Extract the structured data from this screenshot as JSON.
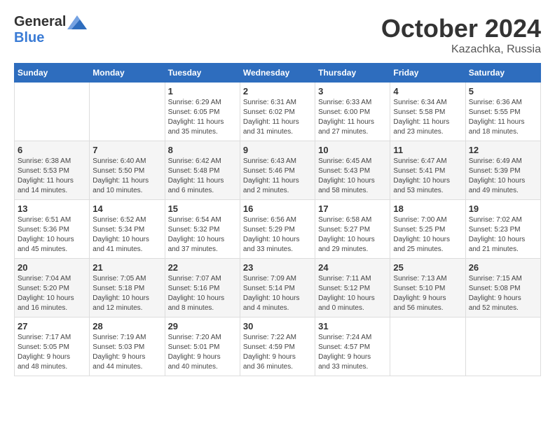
{
  "header": {
    "logo_general": "General",
    "logo_blue": "Blue",
    "month": "October 2024",
    "location": "Kazachka, Russia"
  },
  "weekdays": [
    "Sunday",
    "Monday",
    "Tuesday",
    "Wednesday",
    "Thursday",
    "Friday",
    "Saturday"
  ],
  "weeks": [
    [
      {
        "day": "",
        "info": ""
      },
      {
        "day": "",
        "info": ""
      },
      {
        "day": "1",
        "info": "Sunrise: 6:29 AM\nSunset: 6:05 PM\nDaylight: 11 hours\nand 35 minutes."
      },
      {
        "day": "2",
        "info": "Sunrise: 6:31 AM\nSunset: 6:02 PM\nDaylight: 11 hours\nand 31 minutes."
      },
      {
        "day": "3",
        "info": "Sunrise: 6:33 AM\nSunset: 6:00 PM\nDaylight: 11 hours\nand 27 minutes."
      },
      {
        "day": "4",
        "info": "Sunrise: 6:34 AM\nSunset: 5:58 PM\nDaylight: 11 hours\nand 23 minutes."
      },
      {
        "day": "5",
        "info": "Sunrise: 6:36 AM\nSunset: 5:55 PM\nDaylight: 11 hours\nand 18 minutes."
      }
    ],
    [
      {
        "day": "6",
        "info": "Sunrise: 6:38 AM\nSunset: 5:53 PM\nDaylight: 11 hours\nand 14 minutes."
      },
      {
        "day": "7",
        "info": "Sunrise: 6:40 AM\nSunset: 5:50 PM\nDaylight: 11 hours\nand 10 minutes."
      },
      {
        "day": "8",
        "info": "Sunrise: 6:42 AM\nSunset: 5:48 PM\nDaylight: 11 hours\nand 6 minutes."
      },
      {
        "day": "9",
        "info": "Sunrise: 6:43 AM\nSunset: 5:46 PM\nDaylight: 11 hours\nand 2 minutes."
      },
      {
        "day": "10",
        "info": "Sunrise: 6:45 AM\nSunset: 5:43 PM\nDaylight: 10 hours\nand 58 minutes."
      },
      {
        "day": "11",
        "info": "Sunrise: 6:47 AM\nSunset: 5:41 PM\nDaylight: 10 hours\nand 53 minutes."
      },
      {
        "day": "12",
        "info": "Sunrise: 6:49 AM\nSunset: 5:39 PM\nDaylight: 10 hours\nand 49 minutes."
      }
    ],
    [
      {
        "day": "13",
        "info": "Sunrise: 6:51 AM\nSunset: 5:36 PM\nDaylight: 10 hours\nand 45 minutes."
      },
      {
        "day": "14",
        "info": "Sunrise: 6:52 AM\nSunset: 5:34 PM\nDaylight: 10 hours\nand 41 minutes."
      },
      {
        "day": "15",
        "info": "Sunrise: 6:54 AM\nSunset: 5:32 PM\nDaylight: 10 hours\nand 37 minutes."
      },
      {
        "day": "16",
        "info": "Sunrise: 6:56 AM\nSunset: 5:29 PM\nDaylight: 10 hours\nand 33 minutes."
      },
      {
        "day": "17",
        "info": "Sunrise: 6:58 AM\nSunset: 5:27 PM\nDaylight: 10 hours\nand 29 minutes."
      },
      {
        "day": "18",
        "info": "Sunrise: 7:00 AM\nSunset: 5:25 PM\nDaylight: 10 hours\nand 25 minutes."
      },
      {
        "day": "19",
        "info": "Sunrise: 7:02 AM\nSunset: 5:23 PM\nDaylight: 10 hours\nand 21 minutes."
      }
    ],
    [
      {
        "day": "20",
        "info": "Sunrise: 7:04 AM\nSunset: 5:20 PM\nDaylight: 10 hours\nand 16 minutes."
      },
      {
        "day": "21",
        "info": "Sunrise: 7:05 AM\nSunset: 5:18 PM\nDaylight: 10 hours\nand 12 minutes."
      },
      {
        "day": "22",
        "info": "Sunrise: 7:07 AM\nSunset: 5:16 PM\nDaylight: 10 hours\nand 8 minutes."
      },
      {
        "day": "23",
        "info": "Sunrise: 7:09 AM\nSunset: 5:14 PM\nDaylight: 10 hours\nand 4 minutes."
      },
      {
        "day": "24",
        "info": "Sunrise: 7:11 AM\nSunset: 5:12 PM\nDaylight: 10 hours\nand 0 minutes."
      },
      {
        "day": "25",
        "info": "Sunrise: 7:13 AM\nSunset: 5:10 PM\nDaylight: 9 hours\nand 56 minutes."
      },
      {
        "day": "26",
        "info": "Sunrise: 7:15 AM\nSunset: 5:08 PM\nDaylight: 9 hours\nand 52 minutes."
      }
    ],
    [
      {
        "day": "27",
        "info": "Sunrise: 7:17 AM\nSunset: 5:05 PM\nDaylight: 9 hours\nand 48 minutes."
      },
      {
        "day": "28",
        "info": "Sunrise: 7:19 AM\nSunset: 5:03 PM\nDaylight: 9 hours\nand 44 minutes."
      },
      {
        "day": "29",
        "info": "Sunrise: 7:20 AM\nSunset: 5:01 PM\nDaylight: 9 hours\nand 40 minutes."
      },
      {
        "day": "30",
        "info": "Sunrise: 7:22 AM\nSunset: 4:59 PM\nDaylight: 9 hours\nand 36 minutes."
      },
      {
        "day": "31",
        "info": "Sunrise: 7:24 AM\nSunset: 4:57 PM\nDaylight: 9 hours\nand 33 minutes."
      },
      {
        "day": "",
        "info": ""
      },
      {
        "day": "",
        "info": ""
      }
    ]
  ]
}
